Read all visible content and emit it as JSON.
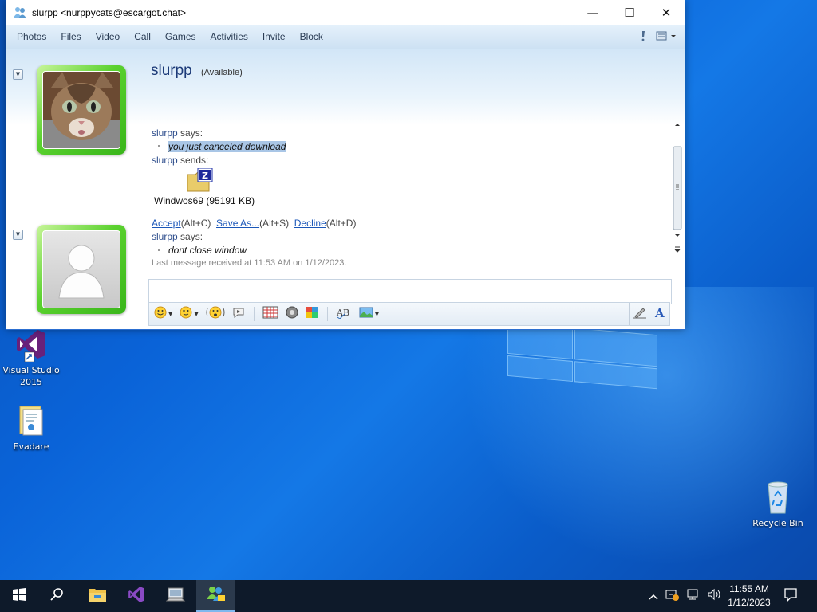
{
  "window": {
    "title": "slurpp <nurppycats@escargot.chat>",
    "minimize_glyph": "—",
    "maximize_glyph": "☐",
    "close_glyph": "✕"
  },
  "menu": {
    "items": [
      "Photos",
      "Files",
      "Video",
      "Call",
      "Games",
      "Activities",
      "Invite",
      "Block"
    ]
  },
  "contact": {
    "name": "slurpp",
    "status": "(Available)"
  },
  "conversation": {
    "says1_name": "slurpp",
    "says1_verb": "says:",
    "msg1": "you just canceled download",
    "sends_name": "slurpp",
    "sends_verb": "sends:",
    "file_label": "Windwos69 (95191 KB)",
    "accept": "Accept",
    "accept_key": "(Alt+C)",
    "saveas": "Save As...",
    "saveas_key": "(Alt+S)",
    "decline": "Decline",
    "decline_key": "(Alt+D)",
    "says2_name": "slurpp",
    "says2_verb": "says:",
    "msg2": "dont close window",
    "last_received": "Last message received at 11:53 AM on 1/12/2023."
  },
  "desktop": {
    "icons": [
      {
        "label": "Visual Studio 2015",
        "icon": "visual-studio-icon"
      },
      {
        "label": "Evadare",
        "icon": "document-folder-icon"
      },
      {
        "label": "Recycle Bin",
        "icon": "recycle-bin-icon"
      }
    ]
  },
  "taskbar": {
    "clock_time": "11:55 AM",
    "clock_date": "1/12/2023",
    "apps": [
      "start-icon",
      "search-icon",
      "file-explorer-icon",
      "visual-studio-icon",
      "computer-icon",
      "messenger-icon"
    ]
  },
  "colors": {
    "desktop_blue": "#0a63d8",
    "taskbar": "#0e1a2a",
    "sender_blue": "#2d4d8c",
    "link_blue": "#1a56b8",
    "avatar_green": "#5ad12e"
  }
}
